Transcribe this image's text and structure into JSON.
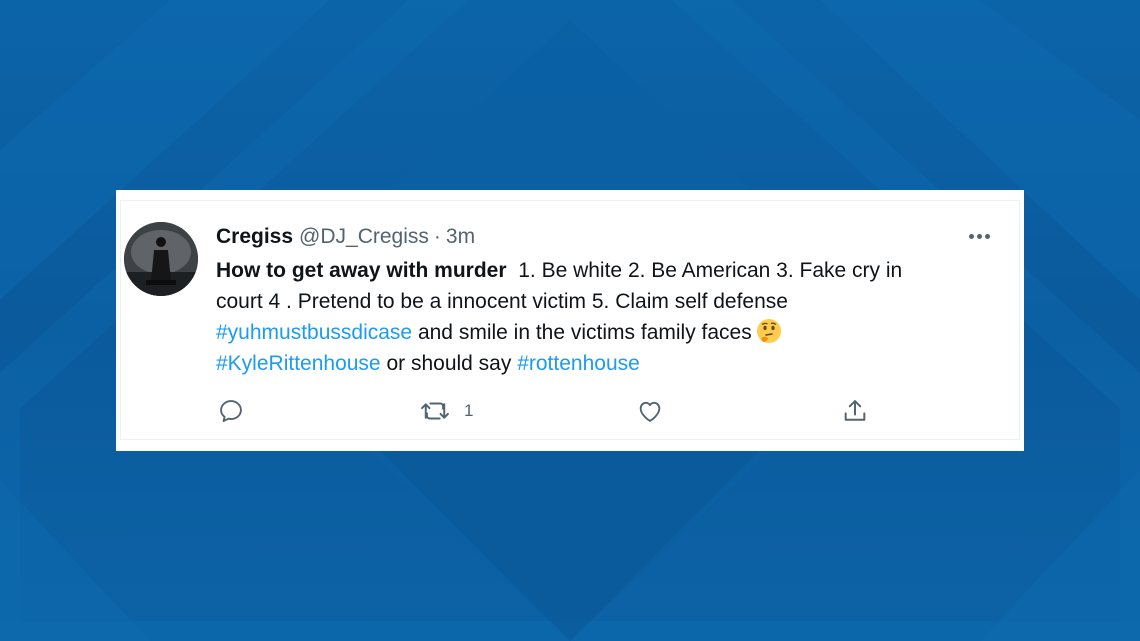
{
  "tweet": {
    "display_name": "Cregiss",
    "handle": "@DJ_Cregiss",
    "separator": "·",
    "time": "3m",
    "text": {
      "bold_intro": "How to get away with murder",
      "line1_rest": "1. Be white 2. Be American 3. Fake cry in",
      "line2": "court 4 . Pretend to be a innocent victim 5. Claim self defense",
      "hashtag1": "#yuhmustbussdicase",
      "line3_rest": "and smile in the victims family faces",
      "hashtag2": "#KyleRittenhouse",
      "line4_mid": "or should say",
      "hashtag3": "#rottenhouse"
    },
    "emoji": "thinking-face-emoji",
    "retweet_count": "1"
  },
  "icons": {
    "reply": "reply-icon",
    "retweet": "retweet-icon",
    "like": "heart-icon",
    "share": "share-icon",
    "more": "more-icon"
  },
  "colors": {
    "background": "#0a5c9e",
    "card": "#ffffff",
    "text": "#0f1419",
    "secondary": "#536471",
    "hashtag": "#1d9bf0"
  }
}
